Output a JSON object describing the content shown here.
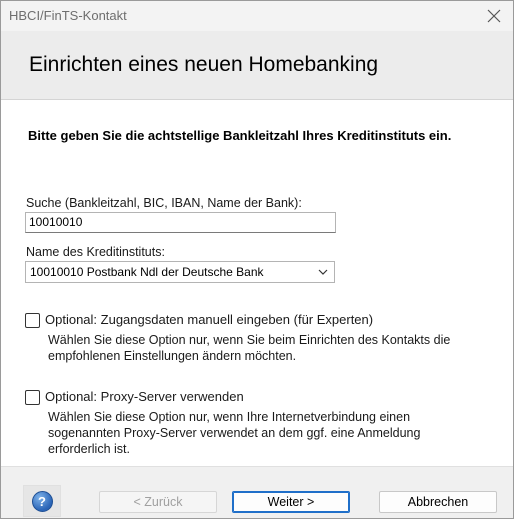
{
  "window": {
    "title": "HBCI/FinTS-Kontakt"
  },
  "header": {
    "heading": "Einrichten eines neuen Homebanking"
  },
  "main": {
    "instruction": "Bitte geben Sie die achtstellige Bankleitzahl Ihres Kreditinstituts ein.",
    "search": {
      "label": "Suche (Bankleitzahl, BIC, IBAN, Name der Bank):",
      "value": "10010010"
    },
    "institute": {
      "label": "Name des Kreditinstituts:",
      "selected": "10010010 Postbank Ndl der Deutsche Bank"
    },
    "option_manual": {
      "label": "Optional: Zugangsdaten manuell eingeben (für Experten)",
      "checked": false,
      "desc_line1": "Wählen Sie diese Option nur, wenn Sie beim Einrichten des Kontakts die",
      "desc_line2": "empfohlenen Einstellungen ändern möchten."
    },
    "option_proxy": {
      "label": "Optional: Proxy-Server verwenden",
      "checked": false,
      "desc_line1": "Wählen Sie diese Option nur, wenn Ihre Internetverbindung einen",
      "desc_line2": "sogenannten Proxy-Server verwendet an dem ggf. eine Anmeldung",
      "desc_line3": "erforderlich ist."
    }
  },
  "footer": {
    "help_symbol": "?",
    "back_label": "< Zurück",
    "next_label": "Weiter >",
    "cancel_label": "Abbrechen"
  },
  "colors": {
    "accent": "#1f6fc9",
    "header_bg": "#ececec",
    "footer_bg": "#f0f0f0"
  }
}
